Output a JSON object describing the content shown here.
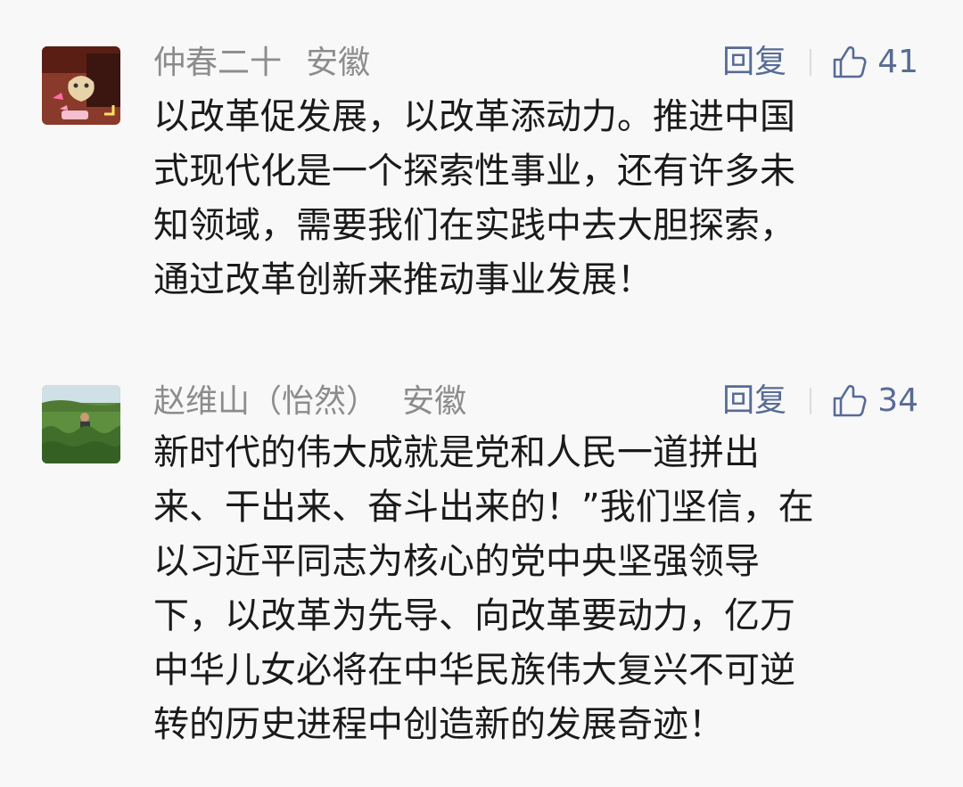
{
  "comments": [
    {
      "nickname": "仲春二十",
      "location": "安徽",
      "reply_label": "回复",
      "like_icon": "thumbs-up-icon",
      "likes": "41",
      "content": "以改革促发展，以改革添动力。推进中国\n式现代化是一个探索性事业，还有许多未\n知领域，需要我们在实践中去大胆探索，\n通过改革创新来推动事业发展！"
    },
    {
      "nickname": "赵维山（怡然）",
      "location": "安徽",
      "reply_label": "回复",
      "like_icon": "thumbs-up-icon",
      "likes": "34",
      "content": "新时代的伟大成就是党和人民一道拼出\n来、干出来、奋斗出来的！”我们坚信，在\n以习近平同志为核心的党中央坚强领导\n下，以改革为先导、向改革要动力，亿万\n中华儿女必将在中华民族伟大复兴不可逆\n转的历史进程中创造新的发展奇迹！"
    }
  ],
  "colors": {
    "link": "#576b95",
    "meta": "#8c8c8c",
    "text": "#1a1a1a",
    "background": "#f8f8f8"
  }
}
